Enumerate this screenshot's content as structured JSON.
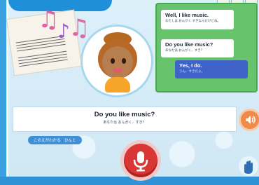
{
  "header": {
    "title": ""
  },
  "chat": {
    "messages": [
      {
        "speaker": "partner",
        "en": "Well, I like music.",
        "jp": "わたしは おんがく すきなんだけどね。"
      },
      {
        "speaker": "partner",
        "en": "Do you like music?",
        "jp": "あなたは おんがく、すき？"
      },
      {
        "speaker": "user",
        "en": "Yes, I do.",
        "jp": "うん、すきだよ。"
      }
    ]
  },
  "prompt": {
    "en": "Do you like music?",
    "jp": "あなたは おんがく、すき？"
  },
  "hint_button": {
    "label": "このえがわかる　ひんと"
  },
  "colors": {
    "accent": "#1f8fd9",
    "chat_panel": "#68c36d",
    "user_bubble": "#3f63c9",
    "mic": "#d93636",
    "sound": "#ee8a4a"
  },
  "icons": {
    "music_notes": "music-note-icon",
    "sound": "speaker-icon",
    "mic": "microphone-icon",
    "hand": "hand-icon"
  }
}
